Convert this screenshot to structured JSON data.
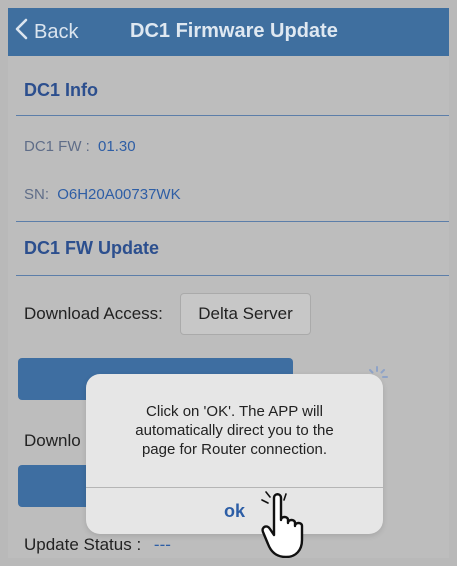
{
  "navbar": {
    "back_label": "Back",
    "title": "DC1 Firmware Update"
  },
  "info": {
    "title": "DC1 Info",
    "fw_label": "DC1 FW :",
    "fw_value": "01.30",
    "sn_label": "SN:",
    "sn_value": "O6H20A00737WK"
  },
  "fw_update": {
    "title": "DC1 FW Update",
    "download_access_label": "Download Access:",
    "download_access_value": "Delta Server",
    "partial_label": "Downlo",
    "update_status_label": "Update Status :",
    "update_status_value": "---"
  },
  "dialog": {
    "message": "Click on 'OK'. The APP will\nautomatically direct you to the\npage for Router connection.",
    "ok_label": "ok"
  },
  "icons": {
    "back": "chevron-left-icon",
    "spinner": "loading-spinner-icon",
    "cursor": "pointing-hand-cursor-icon"
  },
  "colors": {
    "nav_bg": "#3f6f9f",
    "accent": "#2c4f8e",
    "button_bg": "#3e6ea1",
    "dim_bg": "#bdbdbd",
    "dialog_bg": "#e6e6e6"
  }
}
